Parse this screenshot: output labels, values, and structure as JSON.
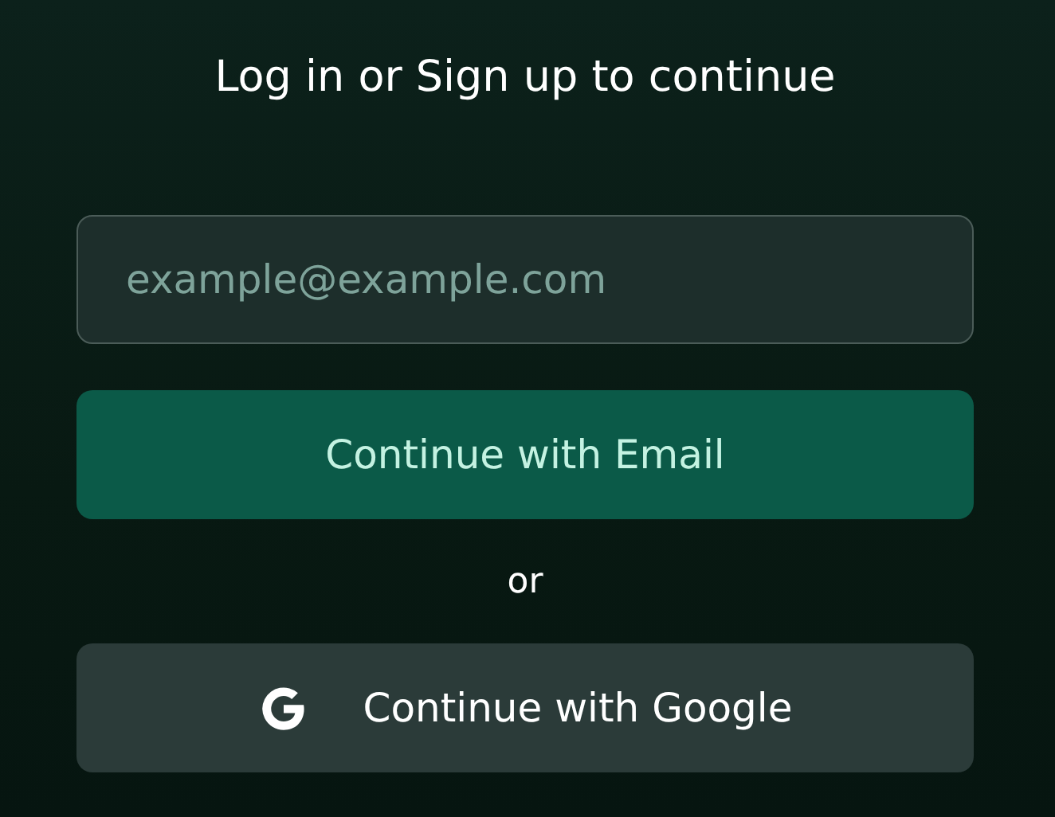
{
  "title": "Log in or Sign up to continue",
  "email_field": {
    "placeholder": "example@example.com"
  },
  "email_button": {
    "label": "Continue with Email"
  },
  "divider": "or",
  "google_button": {
    "label": "Continue with Google"
  }
}
